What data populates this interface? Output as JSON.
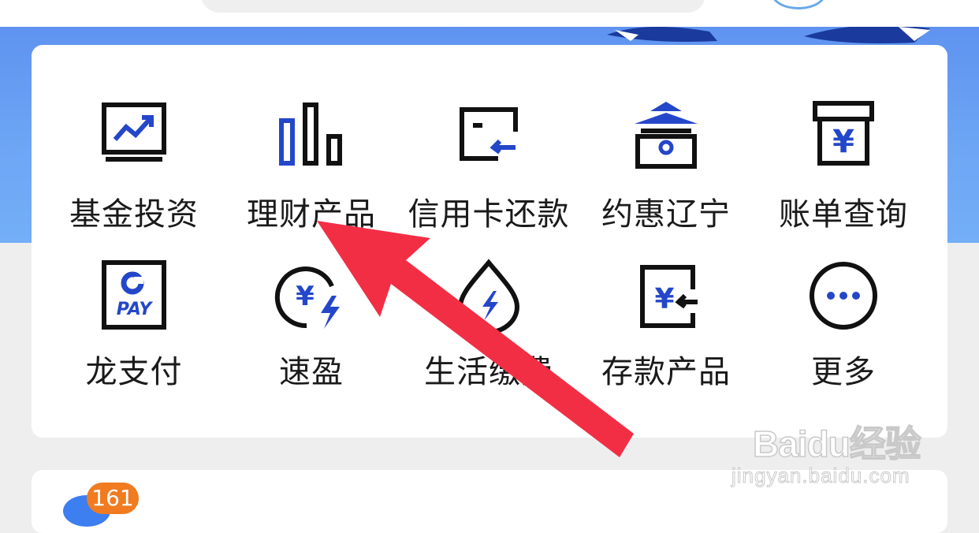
{
  "colors": {
    "banner": "#6aa2f4",
    "icon_stroke": "#111111",
    "icon_accent": "#2447c9",
    "arrow": "#f22e45",
    "badge": "#f07b20"
  },
  "services": [
    {
      "label": "基金投资",
      "icon": "monitor-chart-icon"
    },
    {
      "label": "理财产品",
      "icon": "bar-chart-icon"
    },
    {
      "label": "信用卡还款",
      "icon": "card-repay-icon"
    },
    {
      "label": "约惠辽宁",
      "icon": "pavilion-icon"
    },
    {
      "label": "账单查询",
      "icon": "yuan-box-icon"
    },
    {
      "label": "龙支付",
      "icon": "pay-icon"
    },
    {
      "label": "速盈",
      "icon": "yuan-flash-icon"
    },
    {
      "label": "生活缴费",
      "icon": "drop-flash-icon"
    },
    {
      "label": "存款产品",
      "icon": "deposit-icon"
    },
    {
      "label": "更多",
      "icon": "more-icon"
    }
  ],
  "pay_icon_text": "PAY",
  "yuan_symbol": "¥",
  "notification_badge": "161",
  "watermark": {
    "main": "Baidu经验",
    "sub": "jingyan.baidu.com"
  }
}
